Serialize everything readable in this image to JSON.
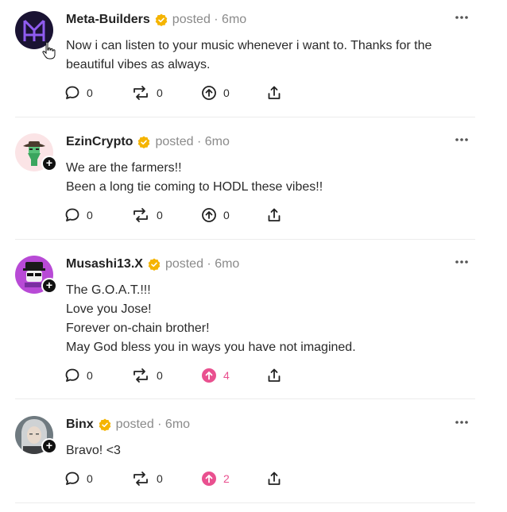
{
  "posts": [
    {
      "author": "Meta-Builders",
      "meta": "posted · 6mo",
      "lines": [
        "Now i can listen to your music whenever i want to. Thanks for the beautiful vibes as always."
      ],
      "comments": "0",
      "reposts": "0",
      "upvotes": "0",
      "upvoted": false
    },
    {
      "author": "EzinCrypto",
      "meta": "posted · 6mo",
      "lines": [
        "We are the farmers!!",
        "Been a long tie coming to HODL these vibes!!"
      ],
      "comments": "0",
      "reposts": "0",
      "upvotes": "0",
      "upvoted": false
    },
    {
      "author": "Musashi13.X",
      "meta": "posted · 6mo",
      "lines": [
        "The G.O.A.T.!!!",
        "Love you Jose!",
        "Forever on-chain brother!",
        "May God bless you in ways you have not imagined."
      ],
      "comments": "0",
      "reposts": "0",
      "upvotes": "4",
      "upvoted": true
    },
    {
      "author": "Binx",
      "meta": "posted · 6mo",
      "lines": [
        "Bravo! <3"
      ],
      "comments": "0",
      "reposts": "0",
      "upvotes": "2",
      "upvoted": true
    }
  ],
  "colors": {
    "verified_badge": "#f5b400",
    "upvote_active": "#e9508f",
    "meta_text": "#8a8a8a"
  },
  "icons": {
    "comment": "comment-icon",
    "repost": "repost-icon",
    "upvote": "upvote-icon",
    "share": "share-icon",
    "more": "more-options-icon",
    "verified": "verified-badge-icon",
    "follow": "plus-icon"
  }
}
